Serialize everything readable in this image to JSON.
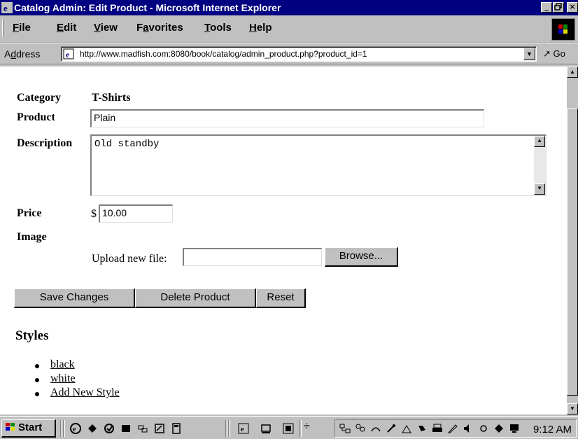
{
  "window": {
    "title": "Catalog Admin: Edit Product - Microsoft Internet Explorer",
    "minimize_glyph": "_",
    "maximize_glyph": "8",
    "close_glyph": "×"
  },
  "menu": {
    "items": [
      {
        "key": "F",
        "rest": "ile"
      },
      {
        "key": "E",
        "rest": "dit"
      },
      {
        "key": "V",
        "rest": "iew"
      },
      {
        "key": "F",
        "pre": "F",
        "rest": "avorites",
        "label": "Favorites"
      },
      {
        "key": "T",
        "rest": "ools"
      },
      {
        "key": "H",
        "rest": "elp"
      }
    ]
  },
  "address": {
    "label_pre": "A",
    "label_key": "d",
    "label_rest": "dress",
    "url": "http://www.madfish.com:8080/book/catalog/admin_product.php?product_id=1",
    "go_label": "Go"
  },
  "form": {
    "category_label": "Category",
    "category_value": "T-Shirts",
    "product_label": "Product",
    "product_value": "Plain",
    "description_label": "Description",
    "description_value": "Old standby",
    "price_label": "Price",
    "price_currency": "$",
    "price_value": "10.00",
    "image_label": "Image",
    "upload_label": "Upload new file:",
    "upload_value": "",
    "browse_label": "Browse..."
  },
  "actions": {
    "save_label": "Save Changes",
    "delete_label": "Delete Product",
    "reset_label": "Reset"
  },
  "styles": {
    "heading": "Styles",
    "items": [
      "black",
      "white",
      "Add New Style"
    ]
  },
  "taskbar": {
    "start_label": "Start",
    "quicklaunch_icons": [
      "ie-icon",
      "channel-icon",
      "outlook-icon",
      "desktop-icon",
      "explorer-icon",
      "notepad-icon",
      "calculator-icon"
    ],
    "task_icons": [
      "ie-task-icon",
      "window-task-icon",
      "app-task-icon"
    ],
    "tray_icons": [
      "network-icon",
      "people-icon",
      "printer-icon",
      "speaker-icon",
      "monitor-icon"
    ],
    "clock": "9:12 AM"
  },
  "colors": {
    "titlebar": "#000080",
    "chrome": "#c0c0c0",
    "page": "#ffffff"
  }
}
